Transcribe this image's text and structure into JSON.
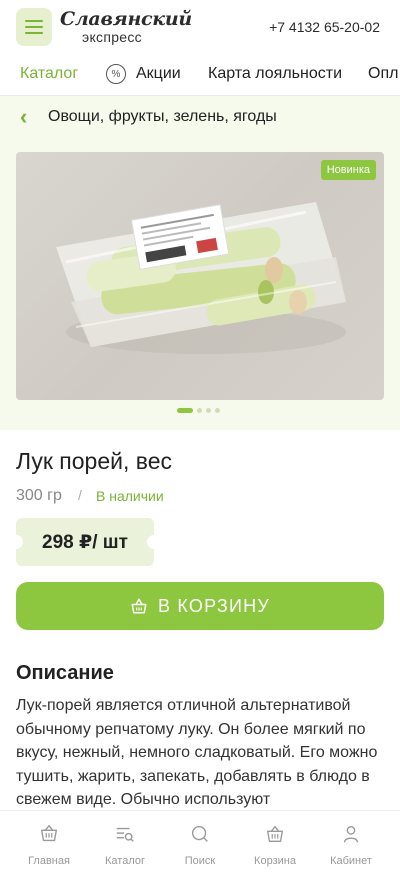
{
  "header": {
    "logo_main": "Славянский",
    "logo_sub": "экспресс",
    "phone": "+7 4132 65-20-02"
  },
  "nav": {
    "items": [
      {
        "label": "Каталог",
        "active": true
      },
      {
        "label": "Акции",
        "icon": "percent-icon"
      },
      {
        "label": "Карта лояльности"
      },
      {
        "label": "Опл"
      }
    ]
  },
  "breadcrumb": {
    "label": "Овощи, фрукты, зелень, ягоды"
  },
  "product": {
    "badge": "Новинка",
    "title": "Лук порей, вес",
    "weight": "300 гр",
    "separator": "/",
    "stock": "В наличии",
    "price": "298 ₽/ шт",
    "add_to_cart": "В КОРЗИНУ",
    "gallery_dots": 4,
    "gallery_active": 0
  },
  "description": {
    "heading": "Описание",
    "text": "Лук-порей является отличной альтернативой обычному репчатому луку. Он более мягкий по вкусу, нежный, немного сладковатый. Его можно тушить, жарить, запекать, добавлять в блюдо в свежем виде. Обычно используют"
  },
  "tabbar": {
    "items": [
      {
        "label": "Главная",
        "icon": "home-basket-icon"
      },
      {
        "label": "Каталог",
        "icon": "catalog-icon"
      },
      {
        "label": "Поиск",
        "icon": "search-icon"
      },
      {
        "label": "Корзина",
        "icon": "basket-icon"
      },
      {
        "label": "Кабинет",
        "icon": "user-icon"
      }
    ]
  },
  "colors": {
    "accent": "#8dc63f",
    "accent_text": "#7ab435",
    "light_green": "#f5faec",
    "price_bg": "#eaf2d9"
  }
}
